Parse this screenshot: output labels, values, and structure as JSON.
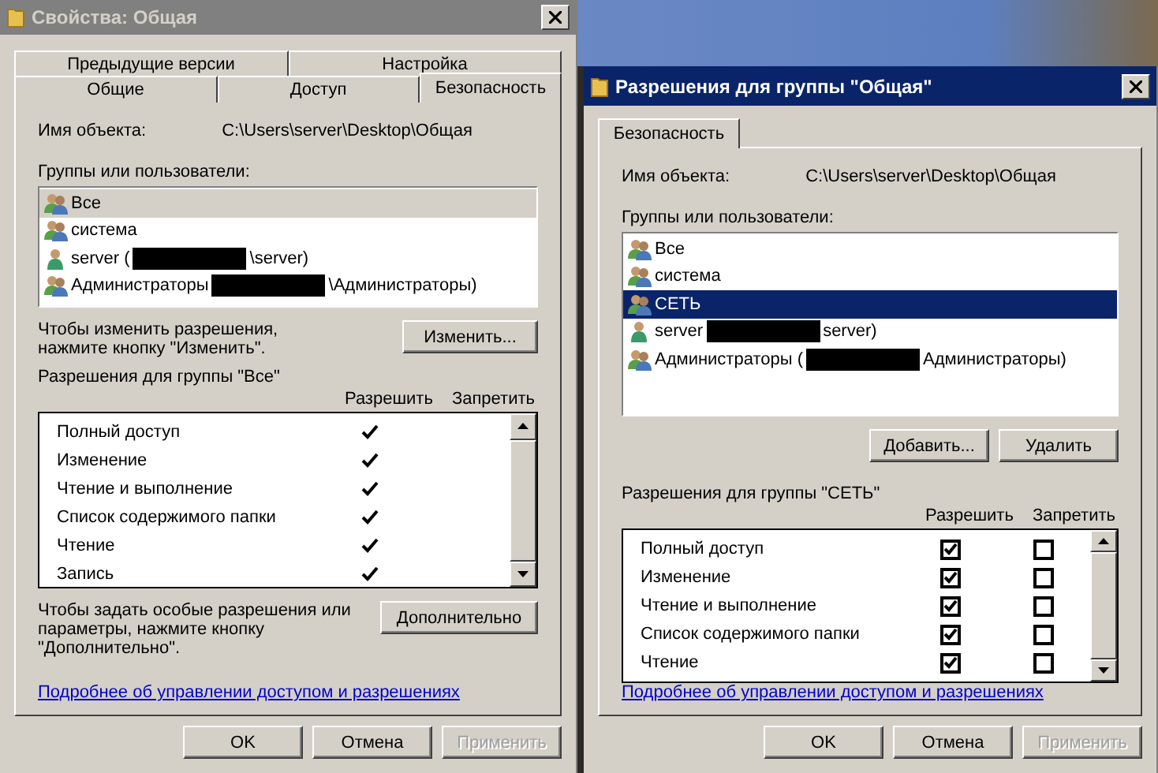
{
  "properties_window": {
    "title": "Свойства: Общая",
    "active": false,
    "tab_rows": [
      [
        {
          "label": "Предыдущие версии",
          "selected": false
        },
        {
          "label": "Настройка",
          "selected": false
        }
      ],
      [
        {
          "label": "Общие",
          "selected": false
        },
        {
          "label": "Доступ",
          "selected": false
        },
        {
          "label": "Безопасность",
          "selected": true
        }
      ]
    ],
    "object_label": "Имя объекта:",
    "object_path": "C:\\Users\\server\\Desktop\\Общая",
    "groups_label": "Группы или пользователи:",
    "principals": [
      {
        "kind": "group",
        "name": "Все",
        "selected": true
      },
      {
        "kind": "group",
        "name": "система",
        "selected": false
      },
      {
        "kind": "user",
        "name": "server (",
        "redacted": true,
        "suffix": "\\server)",
        "selected": false
      },
      {
        "kind": "group",
        "name": "Администраторы",
        "redacted": true,
        "suffix": "\\Администраторы)",
        "selected": false
      }
    ],
    "change_hint": "Чтобы изменить разрешения,\nнажмите кнопку \"Изменить\".",
    "change_button": "Изменить...",
    "permissions_label": "Разрешения для группы \"Все\"",
    "columns": [
      "Разрешить",
      "Запретить"
    ],
    "permissions": [
      {
        "kind": "checkmark",
        "name": "Полный доступ",
        "allow": true
      },
      {
        "kind": "checkmark",
        "name": "Изменение",
        "allow": true
      },
      {
        "kind": "checkmark",
        "name": "Чтение и выполнение",
        "allow": true
      },
      {
        "kind": "checkmark",
        "name": "Список содержимого папки",
        "allow": true
      },
      {
        "kind": "checkmark",
        "name": "Чтение",
        "allow": true
      },
      {
        "kind": "checkmark",
        "name": "Запись",
        "allow": true
      }
    ],
    "advanced_hint": "Чтобы задать особые разрешения или\nпараметры, нажмите кнопку\n\"Дополнительно\".",
    "advanced_button": "Дополнительно",
    "link": "Подробнее об управлении доступом и разрешениях",
    "buttons": [
      {
        "label": "OK",
        "disabled": false
      },
      {
        "label": "Отмена",
        "disabled": false
      },
      {
        "label": "Применить",
        "disabled": true
      }
    ]
  },
  "permissions_window": {
    "title": "Разрешения для группы \"Общая\"",
    "active": true,
    "tab_rows": [
      [
        {
          "label": "Безопасность",
          "selected": true
        }
      ]
    ],
    "object_label": "Имя объекта:",
    "object_path": "C:\\Users\\server\\Desktop\\Общая",
    "groups_label": "Группы или пользователи:",
    "principals": [
      {
        "kind": "group",
        "name": "Все",
        "selected": false
      },
      {
        "kind": "group",
        "name": "система",
        "selected": false
      },
      {
        "kind": "group",
        "name": "СЕТЬ",
        "selected": true
      },
      {
        "kind": "user",
        "name": "server",
        "redacted": true,
        "suffix": "server)",
        "selected": false
      },
      {
        "kind": "group",
        "name": "Администраторы (",
        "redacted": true,
        "suffix": "Администраторы)",
        "selected": false
      }
    ],
    "action_buttons": [
      "Добавить...",
      "Удалить"
    ],
    "permissions_label": "Разрешения для группы \"СЕТЬ\"",
    "columns": [
      "Разрешить",
      "Запретить"
    ],
    "permissions": [
      {
        "kind": "checkbox",
        "name": "Полный доступ",
        "allow": true,
        "deny": false
      },
      {
        "kind": "checkbox",
        "name": "Изменение",
        "allow": true,
        "deny": false
      },
      {
        "kind": "checkbox",
        "name": "Чтение и выполнение",
        "allow": true,
        "deny": false
      },
      {
        "kind": "checkbox",
        "name": "Список содержимого папки",
        "allow": true,
        "deny": false
      },
      {
        "kind": "checkbox",
        "name": "Чтение",
        "allow": true,
        "deny": false
      }
    ],
    "link": "Подробнее об управлении доступом и разрешениях",
    "buttons": [
      {
        "label": "OK",
        "disabled": false
      },
      {
        "label": "Отмена",
        "disabled": false
      },
      {
        "label": "Применить",
        "disabled": true
      }
    ]
  }
}
